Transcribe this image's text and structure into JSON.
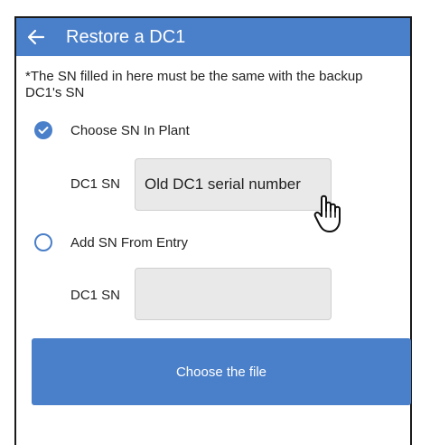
{
  "header": {
    "title": "Restore a DC1",
    "back_icon": "arrow-left-icon"
  },
  "note": "*The SN filled in here must be the same with the backup DC1's SN",
  "options": [
    {
      "label": "Choose SN In Plant",
      "checked": true,
      "sn_label": "DC1 SN",
      "sn_value": "Old DC1 serial number"
    },
    {
      "label": "Add SN From Entry",
      "checked": false,
      "sn_label": "DC1 SN",
      "sn_value": ""
    }
  ],
  "choose_file_button": "Choose the file",
  "colors": {
    "accent": "#4a7fc9",
    "field_bg": "#e9e9e9"
  }
}
